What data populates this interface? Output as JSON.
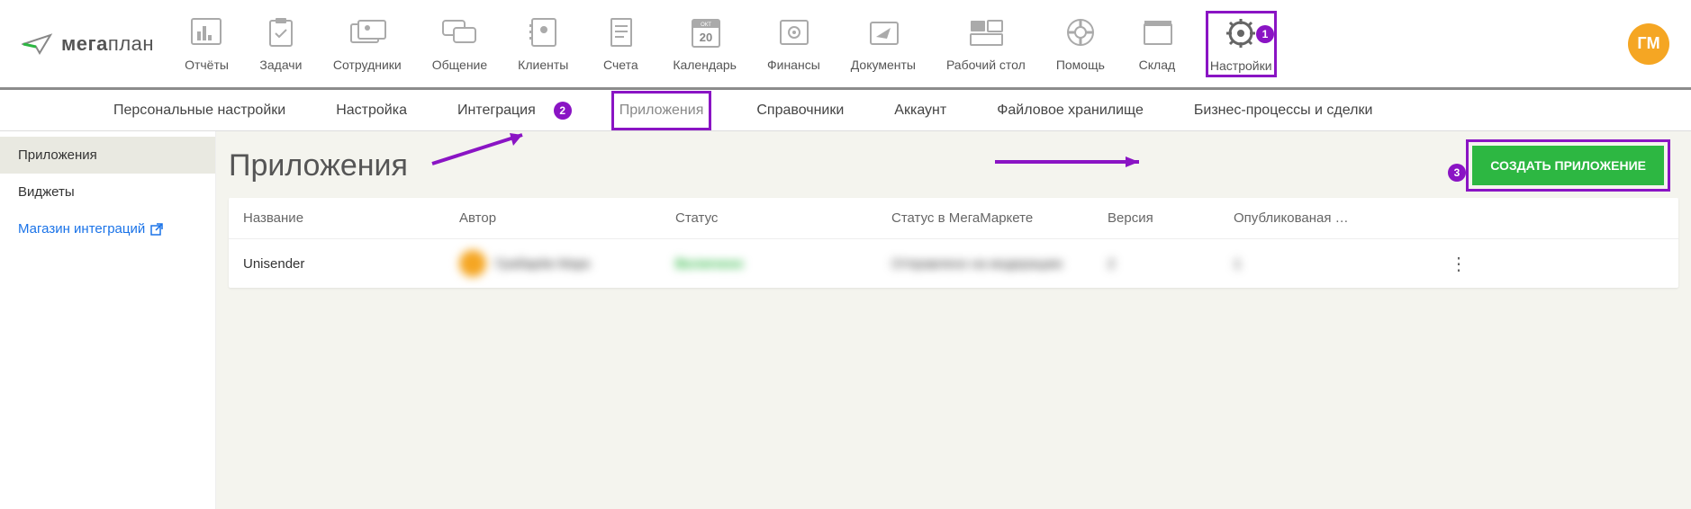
{
  "brand": {
    "name_bold": "мега",
    "name_rest": "план"
  },
  "nav": [
    {
      "label": "Отчёты"
    },
    {
      "label": "Задачи"
    },
    {
      "label": "Сотрудники"
    },
    {
      "label": "Общение"
    },
    {
      "label": "Клиенты"
    },
    {
      "label": "Счета"
    },
    {
      "label": "Календарь",
      "badge": "ОКТ",
      "day": "20"
    },
    {
      "label": "Финансы"
    },
    {
      "label": "Документы"
    },
    {
      "label": "Рабочий стол"
    },
    {
      "label": "Помощь"
    },
    {
      "label": "Склад"
    },
    {
      "label": "Настройки"
    }
  ],
  "avatar": "ГМ",
  "callouts": {
    "one": "1",
    "two": "2",
    "three": "3"
  },
  "subnav": [
    "Персональные настройки",
    "Настройка",
    "Интеграция",
    "Приложения",
    "Справочники",
    "Аккаунт",
    "Файловое хранилище",
    "Бизнес-процессы и сделки"
  ],
  "sidebar": {
    "items": [
      "Приложения",
      "Виджеты"
    ],
    "store": "Магазин интеграций"
  },
  "page": {
    "title": "Приложения",
    "create": "СОЗДАТЬ ПРИЛОЖЕНИЕ"
  },
  "table": {
    "headers": [
      "Название",
      "Автор",
      "Статус",
      "Статус в МегаМаркете",
      "Версия",
      "Опубликованая …"
    ],
    "rows": [
      {
        "name": "Unisender",
        "author": "Грабарёв Марк",
        "status": "Включено",
        "market_status": "Отправлено на модерацию",
        "version": "2",
        "published": "1"
      }
    ]
  }
}
